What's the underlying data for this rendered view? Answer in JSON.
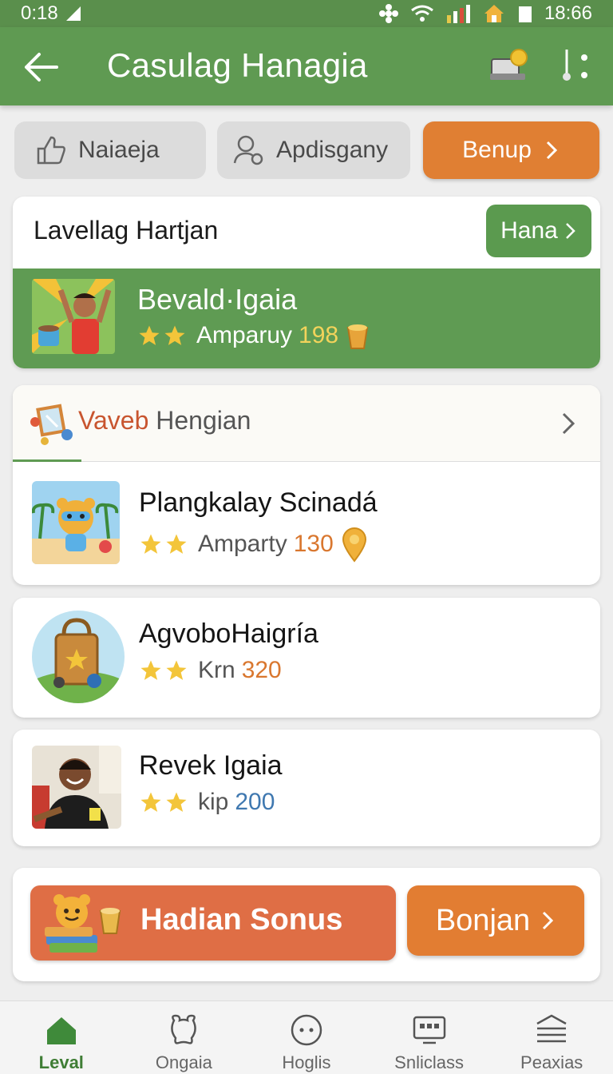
{
  "status_bar": {
    "time_left": "0:18",
    "time_right": "18:66"
  },
  "app_bar": {
    "title": "Casulag Hanagia"
  },
  "chips": [
    {
      "label": "Naiaeja"
    },
    {
      "label": "Apdisgany"
    },
    {
      "label": "Benup"
    }
  ],
  "section1": {
    "heading": "Lavellag Hartjan",
    "button_label": "Hana",
    "featured": {
      "name": "Bevald·Igaia",
      "meta_label": "Amparuy",
      "meta_value": "198"
    }
  },
  "section2": {
    "title_accent": "Vaveb",
    "title_rest": " Hengian",
    "items": [
      {
        "name": "Plangkalay Scinadá",
        "meta_label": "Amparty",
        "meta_value": "130"
      }
    ]
  },
  "list": [
    {
      "name": "AgvoboHaigría",
      "meta_label": "Krn",
      "meta_value": "320"
    },
    {
      "name": "Revek Igaia",
      "meta_label": "kip",
      "meta_value": "200"
    }
  ],
  "bonus": {
    "label": "Hadian Sonus",
    "button_label": "Bonjan"
  },
  "bottom_nav": [
    {
      "label": "Leval",
      "icon": "home-icon"
    },
    {
      "label": "Ongaia",
      "icon": "bear-icon"
    },
    {
      "label": "Hoglis",
      "icon": "face-icon"
    },
    {
      "label": "Snliclass",
      "icon": "monitor-icon"
    },
    {
      "label": "Peaxias",
      "icon": "layers-icon"
    }
  ],
  "colors": {
    "primary_green": "#5f9a52",
    "accent_orange": "#e07f33",
    "bonus_red": "#df6e45"
  }
}
